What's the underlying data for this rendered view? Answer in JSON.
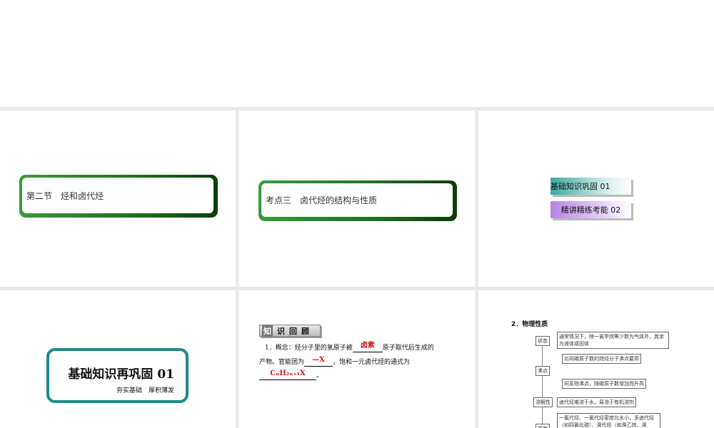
{
  "slides": [
    {
      "title": "第二节　烃和卤代烃"
    },
    {
      "title": "考点三　卤代烃的结构与性质"
    },
    {
      "menu": [
        "基础知识巩固 01",
        "精讲精练考能 02"
      ]
    },
    {
      "title": "基础知识再巩固 01",
      "subtitle": "夯实基础　厚积薄发"
    },
    {
      "badge": [
        "知",
        "识",
        "回",
        "顾"
      ],
      "line1_a": "1．概念：烃分子里的氢原子被",
      "answer1": "卤素",
      "line1_b": "原子取代后生成的",
      "line2_a": "产物。官能团为",
      "answer2": "—X",
      "line2_b": "，饱和一元卤代烃的通式为",
      "answer3": "CₙH₂ₙ₊₁X",
      "line3_b": "。"
    },
    {
      "title": "2．物理性质",
      "nodes": [
        "状态",
        "沸点",
        "溶解性",
        "密度"
      ],
      "texts": [
        "通常情况下，除一氯甲烷等少数为气体外，其余为液体或固体",
        "比同碳原子数的烷烃分子沸点要高",
        "同系物沸点，随碳原子数增加而升高",
        "卤代烃难溶于水，易溶于有机溶剂",
        "一氟代烃、一氯代烃密度比水小，多卤代烃（如四氯化碳）、溴代烃（如溴乙烷、溴苯）、碘"
      ]
    }
  ]
}
